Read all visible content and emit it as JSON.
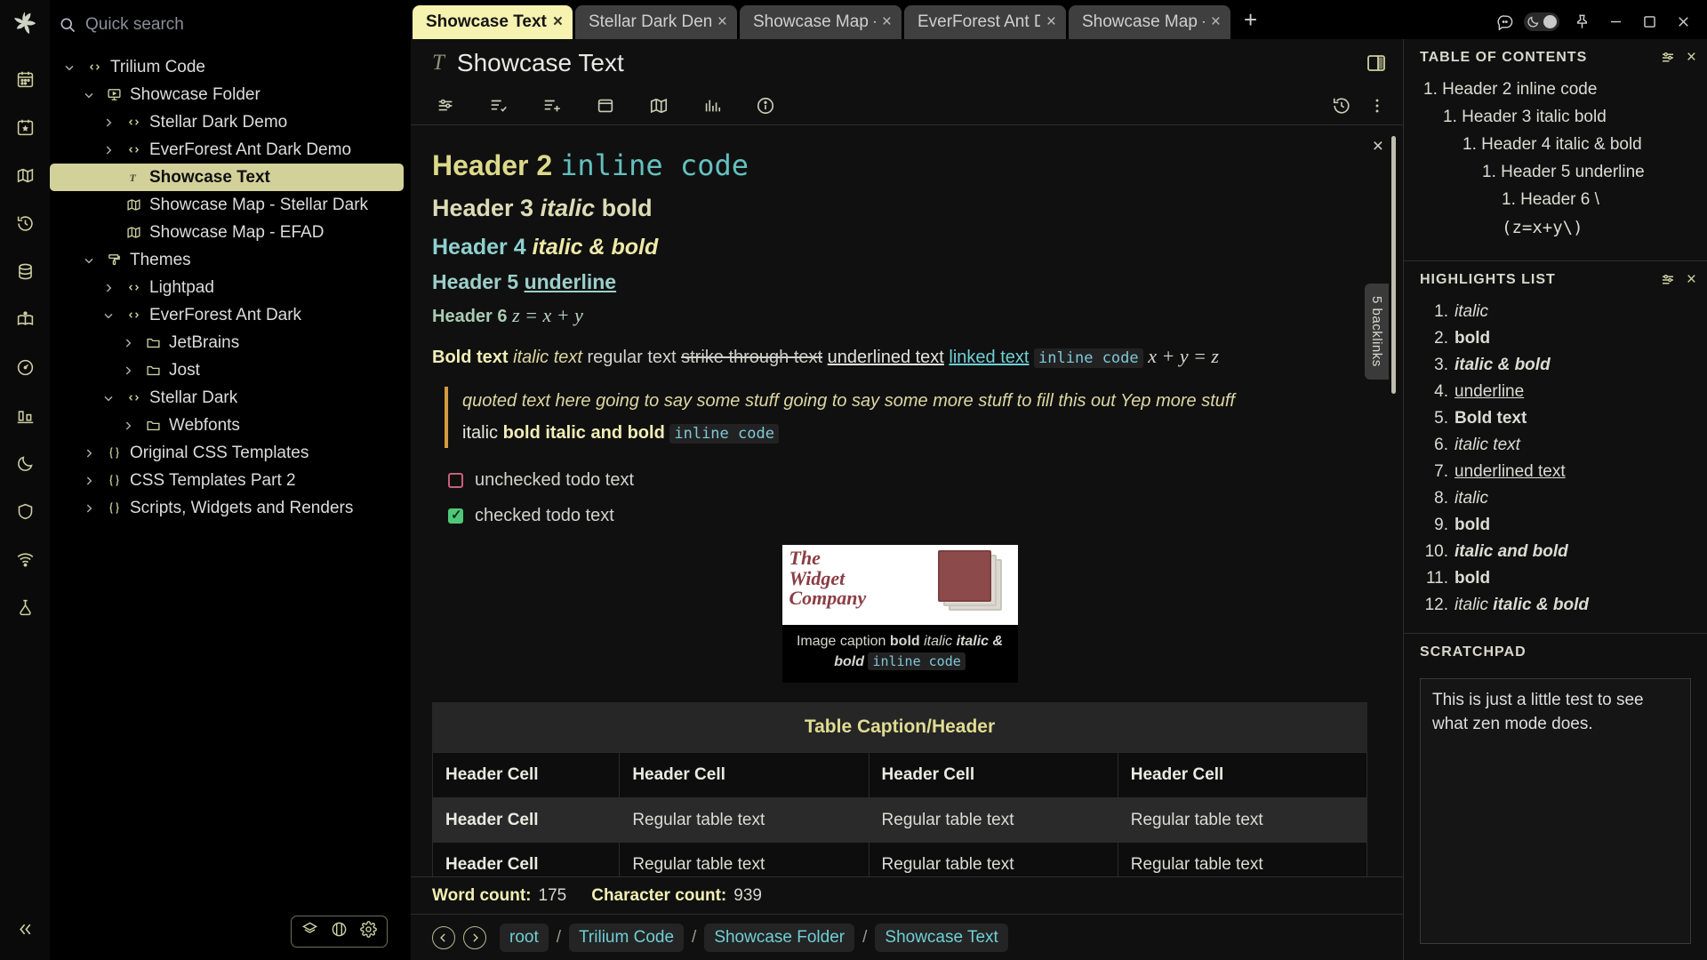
{
  "rail": {
    "logo": "trilium-leaf-logo",
    "items": [
      {
        "name": "calendar-icon"
      },
      {
        "name": "bookmark-calendar-icon"
      },
      {
        "name": "map-icon"
      },
      {
        "name": "history-icon"
      },
      {
        "name": "database-icon"
      },
      {
        "name": "book-icon"
      },
      {
        "name": "gauge-icon"
      },
      {
        "name": "stats-icon"
      },
      {
        "name": "moon-icon"
      },
      {
        "name": "shield-icon"
      },
      {
        "name": "wifi-icon"
      },
      {
        "name": "flask-icon"
      }
    ],
    "collapse_label": "«"
  },
  "search": {
    "placeholder": "Quick search",
    "value": ""
  },
  "tree": {
    "items": [
      {
        "label": "Trilium Code",
        "depth": 0,
        "chev": "down",
        "icon": "code-icon",
        "selected": false
      },
      {
        "label": "Showcase Folder",
        "depth": 1,
        "chev": "down",
        "icon": "display-icon",
        "selected": false
      },
      {
        "label": "Stellar Dark Demo",
        "depth": 2,
        "chev": "right",
        "icon": "code-icon",
        "selected": false
      },
      {
        "label": "EverForest Ant Dark Demo",
        "depth": 2,
        "chev": "right",
        "icon": "code-icon",
        "selected": false
      },
      {
        "label": "Showcase Text",
        "depth": 2,
        "chev": "none",
        "icon": "text-icon",
        "selected": true
      },
      {
        "label": "Showcase Map - Stellar Dark",
        "depth": 2,
        "chev": "none",
        "icon": "map-icon",
        "selected": false
      },
      {
        "label": "Showcase Map - EFAD",
        "depth": 2,
        "chev": "none",
        "icon": "map-icon",
        "selected": false
      },
      {
        "label": "Themes",
        "depth": 1,
        "chev": "down",
        "icon": "paint-icon",
        "selected": false
      },
      {
        "label": "Lightpad",
        "depth": 2,
        "chev": "right",
        "icon": "code-icon",
        "selected": false
      },
      {
        "label": "EverForest Ant Dark",
        "depth": 2,
        "chev": "down",
        "icon": "code-icon",
        "selected": false
      },
      {
        "label": "JetBrains",
        "depth": 3,
        "chev": "right",
        "icon": "folder-icon",
        "selected": false
      },
      {
        "label": "Jost",
        "depth": 3,
        "chev": "right",
        "icon": "folder-icon",
        "selected": false
      },
      {
        "label": "Stellar Dark",
        "depth": 2,
        "chev": "down",
        "icon": "code-icon",
        "selected": false
      },
      {
        "label": "Webfonts",
        "depth": 3,
        "chev": "right",
        "icon": "folder-icon",
        "selected": false
      },
      {
        "label": "Original CSS Templates",
        "depth": 1,
        "chev": "right",
        "icon": "braces-icon",
        "selected": false
      },
      {
        "label": "CSS Templates Part 2",
        "depth": 1,
        "chev": "right",
        "icon": "braces-icon",
        "selected": false
      },
      {
        "label": "Scripts, Widgets and Renders",
        "depth": 1,
        "chev": "right",
        "icon": "braces-icon",
        "selected": false
      }
    ]
  },
  "tabs": {
    "items": [
      {
        "label": "Showcase Text",
        "active": true
      },
      {
        "label": "Stellar Dark Den",
        "active": false
      },
      {
        "label": "Showcase Map -",
        "active": false
      },
      {
        "label": "EverForest Ant D",
        "active": false
      },
      {
        "label": "Showcase Map -",
        "active": false
      }
    ],
    "new_tab_label": "+"
  },
  "window": {
    "buttons": [
      "comment-icon",
      "theme-toggle",
      "pin-icon",
      "minimize-icon",
      "maximize-icon",
      "close-icon"
    ]
  },
  "note": {
    "title": "Showcase Text",
    "type_icon": "T",
    "ribbon_icons": [
      "sliders-icon",
      "checklist-icon",
      "add-list-icon",
      "box-icon",
      "map-icon",
      "chart-icon",
      "info-icon",
      "history-icon",
      "more-icon"
    ],
    "backlinks_label": "5 backlinks",
    "close_label": "×"
  },
  "body": {
    "h2": {
      "prefix": "Header 2",
      "code": "inline code"
    },
    "h3": {
      "prefix": "Header 3",
      "italic": "italic",
      "bold": "bold"
    },
    "h4": {
      "prefix": "Header 4",
      "italic_bold": "italic & bold"
    },
    "h5": {
      "prefix": "Header 5",
      "underline": "underline"
    },
    "h6": {
      "prefix": "Header 6",
      "math": "z = x + y"
    },
    "para": {
      "bold": "Bold text",
      "italic": "italic text",
      "regular": "regular text",
      "strike": "strike through text",
      "underline": "underlined text",
      "link": "linked text",
      "code": "inline code",
      "math": "x + y = z"
    },
    "quote": {
      "line1": "quoted text here going to say some stuff going to say some more stuff to fill this out Yep more stuff",
      "line2_plain": "italic ",
      "line2_bold": "bold italic and bold",
      "line2_code": "inline code"
    },
    "todos": [
      {
        "label": "unchecked todo text",
        "checked": false
      },
      {
        "label": "checked todo text",
        "checked": true
      }
    ],
    "figure": {
      "brand_line1": "The",
      "brand_line2": "Widget",
      "brand_line3": "Company",
      "caption_plain": "Image caption ",
      "caption_bold": "bold",
      "caption_italic": "italic",
      "caption_italic_bold": "italic & bold",
      "caption_code": "inline code"
    },
    "table": {
      "caption": "Table Caption/Header",
      "header": [
        "Header Cell",
        "Header Cell",
        "Header Cell",
        "Header Cell"
      ],
      "rows": [
        [
          "Header Cell",
          "Regular table text",
          "Regular table text",
          "Regular table text"
        ],
        [
          "Header Cell",
          "Regular table text",
          "Regular table text",
          "Regular table text"
        ]
      ]
    }
  },
  "status": {
    "word_count_label": "Word count:",
    "word_count": "175",
    "char_count_label": "Character count:",
    "char_count": "939"
  },
  "breadcrumb": {
    "back_icon": "arrow-left-icon",
    "forward_icon": "arrow-right-icon",
    "items": [
      "root",
      "Trilium Code",
      "Showcase Folder",
      "Showcase Text"
    ],
    "separator": "/"
  },
  "right_panel": {
    "toc": {
      "title": "TABLE OF CONTENTS",
      "items": [
        {
          "num": "1.",
          "text": "Header 2 inline code",
          "level": 1
        },
        {
          "num": "1.",
          "text": "Header 3 italic bold",
          "level": 2
        },
        {
          "num": "1.",
          "text": "Header 4 italic & bold",
          "level": 3
        },
        {
          "num": "1.",
          "text": "Header 5 underline",
          "level": 4
        },
        {
          "num": "1.",
          "text": "Header 6 \\",
          "level": 5
        },
        {
          "num": "",
          "text": "(z=x+y\\)",
          "level": 5
        }
      ]
    },
    "highlights": {
      "title": "HIGHLIGHTS LIST",
      "items": [
        {
          "num": "1.",
          "text": "italic",
          "style": "i"
        },
        {
          "num": "2.",
          "text": "bold",
          "style": "b"
        },
        {
          "num": "3.",
          "text": "italic & bold",
          "style": "ib"
        },
        {
          "num": "4.",
          "text": "underline",
          "style": "u"
        },
        {
          "num": "5.",
          "text": "Bold text",
          "style": "b"
        },
        {
          "num": "6.",
          "text": "italic text",
          "style": "i"
        },
        {
          "num": "7.",
          "text": "underlined text",
          "style": "u"
        },
        {
          "num": "8.",
          "text": "italic",
          "style": "i"
        },
        {
          "num": "9.",
          "text": "bold",
          "style": "b"
        },
        {
          "num": "10.",
          "text": "italic and bold",
          "style": "ib"
        },
        {
          "num": "11.",
          "text": "bold",
          "style": "b"
        },
        {
          "num": "12.",
          "text": "italic italic & bold",
          "style": "mix"
        }
      ]
    },
    "scratchpad": {
      "title": "SCRATCHPAD",
      "value": "This is just a little test to see what zen mode does."
    }
  },
  "colors": {
    "accent": "#ccd0a0",
    "active_tab": "#f6f2b0",
    "selection": "#d3d19a",
    "link": "#6fcfd6",
    "code": "#64c0c0",
    "quote_bar": "#d49b3c"
  }
}
